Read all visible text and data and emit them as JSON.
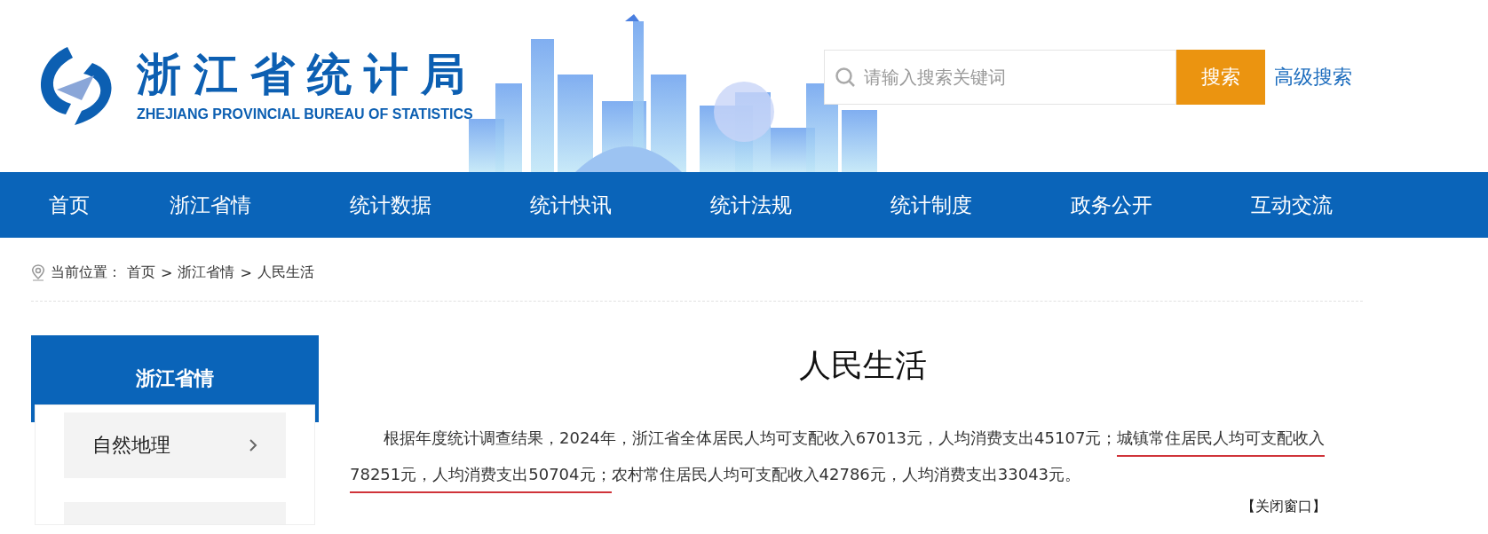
{
  "header": {
    "logo_title": "浙江省统计局",
    "logo_subtitle": "ZHEJIANG PROVINCIAL BUREAU OF STATISTICS",
    "search": {
      "placeholder": "请输入搜索关键词"
    },
    "search_button": "搜索",
    "advanced_search": "高级搜索"
  },
  "nav": [
    {
      "label": "首页"
    },
    {
      "label": "浙江省情"
    },
    {
      "label": "统计数据"
    },
    {
      "label": "统计快讯"
    },
    {
      "label": "统计法规"
    },
    {
      "label": "统计制度"
    },
    {
      "label": "政务公开"
    },
    {
      "label": "互动交流"
    }
  ],
  "breadcrumb": {
    "label": "当前位置：",
    "items": [
      "首页",
      "浙江省情",
      "人民生活"
    ],
    "separator": ">"
  },
  "sidebar": {
    "title": "浙江省情",
    "items": [
      {
        "kind": "link",
        "label": "自然地理"
      },
      {
        "kind": "blank"
      }
    ]
  },
  "article": {
    "title": "人民生活",
    "paragraph": [
      {
        "text": "根据年度统计调查结果，2024年，浙江省全体居民人均可支配收入67013元，人均消费支出45107元；",
        "underlined": false
      },
      {
        "text": "城镇常住居民人均可支配收入78251元，人均消费支出50704元；",
        "underlined": true
      },
      {
        "text": "农村常住居民人均可支配收入42786元，人均消费支出33043元。",
        "underlined": false
      }
    ],
    "close_link": "【关闭窗口】"
  }
}
